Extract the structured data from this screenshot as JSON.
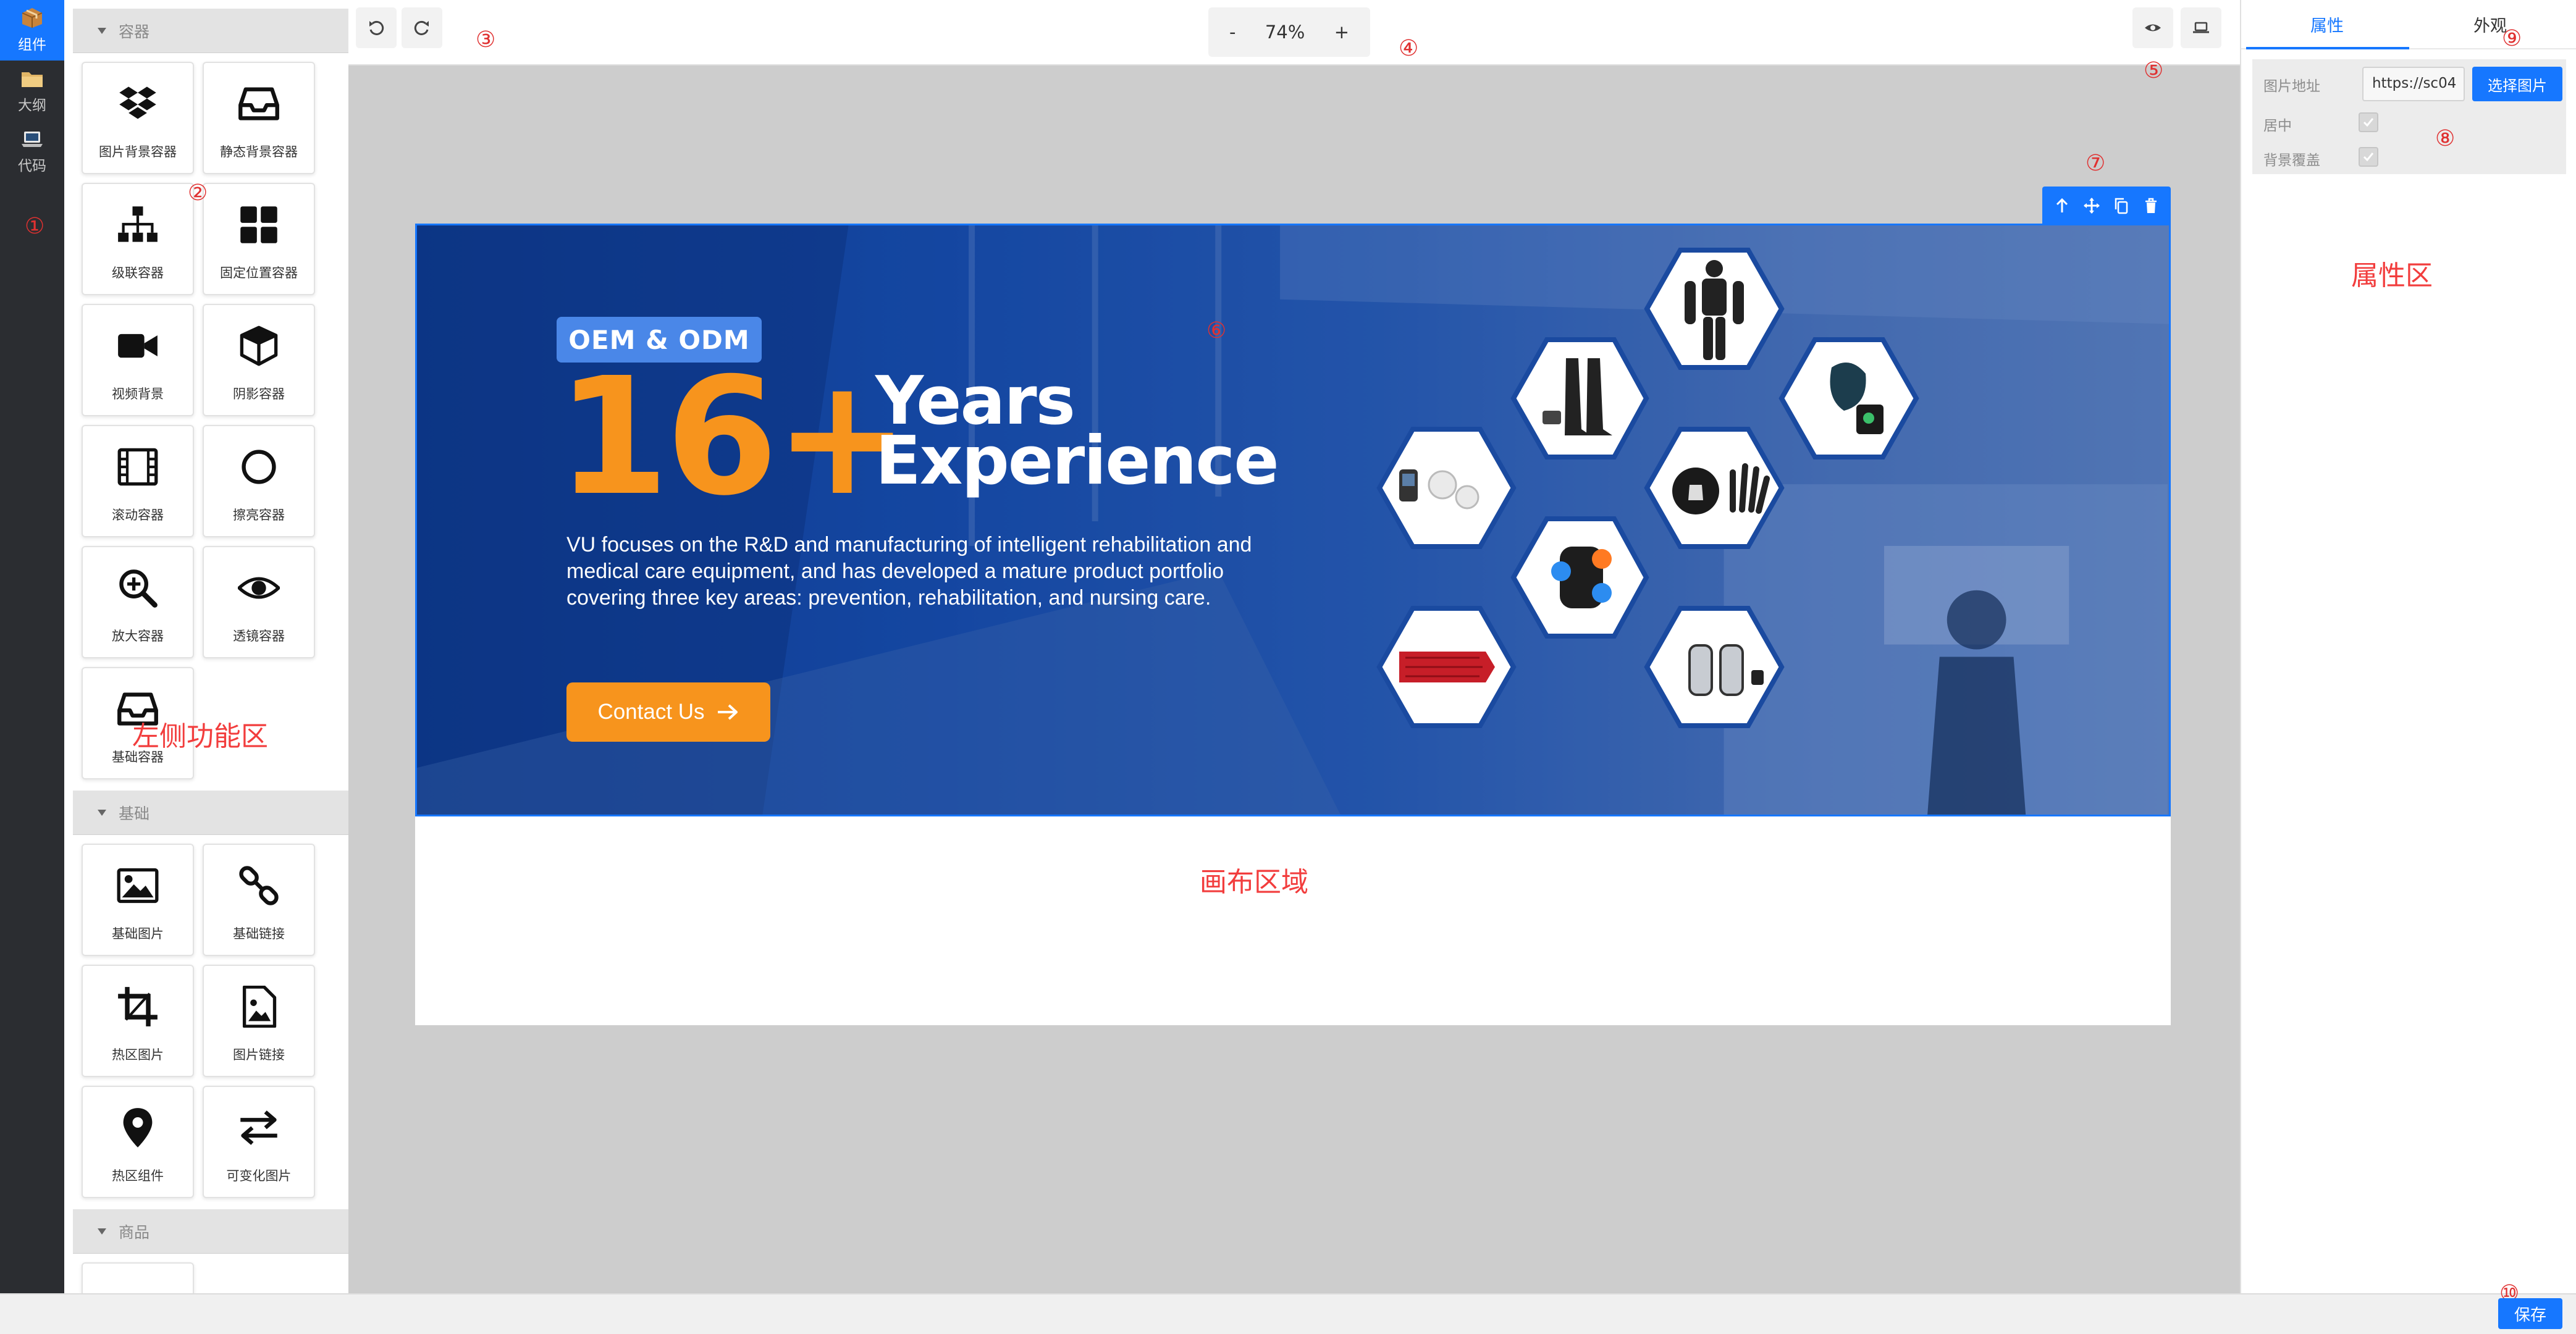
{
  "rail": {
    "items": [
      {
        "label": "组件",
        "icon": "package-icon",
        "active": true
      },
      {
        "label": "大纲",
        "icon": "folder-icon",
        "active": false
      },
      {
        "label": "代码",
        "icon": "laptop-icon",
        "active": false
      }
    ]
  },
  "panel": {
    "region_label": "左侧功能区",
    "groups": [
      {
        "title": "容器",
        "items": [
          {
            "label": "图片背景容器",
            "icon": "dropbox-icon"
          },
          {
            "label": "静态背景容器",
            "icon": "inbox-icon"
          },
          {
            "label": "级联容器",
            "icon": "sitemap-icon"
          },
          {
            "label": "固定位置容器",
            "icon": "grid-icon"
          },
          {
            "label": "视频背景",
            "icon": "video-icon"
          },
          {
            "label": "阴影容器",
            "icon": "cube-icon"
          },
          {
            "label": "滚动容器",
            "icon": "film-icon"
          },
          {
            "label": "擦亮容器",
            "icon": "circle-icon"
          },
          {
            "label": "放大容器",
            "icon": "zoom-in-icon"
          },
          {
            "label": "透镜容器",
            "icon": "eye-icon"
          },
          {
            "label": "基础容器",
            "icon": "inbox-icon"
          }
        ]
      },
      {
        "title": "基础",
        "items": [
          {
            "label": "基础图片",
            "icon": "image-icon"
          },
          {
            "label": "基础链接",
            "icon": "link-icon"
          },
          {
            "label": "热区图片",
            "icon": "crop-icon"
          },
          {
            "label": "图片链接",
            "icon": "image-file-icon"
          },
          {
            "label": "热区组件",
            "icon": "map-pin-icon"
          },
          {
            "label": "可变化图片",
            "icon": "swap-icon"
          }
        ]
      },
      {
        "title": "商品",
        "items": [
          {
            "label": "",
            "icon": "grid-icon"
          }
        ]
      }
    ]
  },
  "toolbar": {
    "zoom_minus": "-",
    "zoom_value": "74%",
    "zoom_plus": "+"
  },
  "markers": {
    "m1": "①",
    "m2": "②",
    "m3": "③",
    "m4": "④",
    "m5": "⑤",
    "m6": "⑥",
    "m7": "⑦",
    "m8": "⑧",
    "m9": "⑨",
    "m10": "⑩"
  },
  "banner": {
    "badge": "OEM & ODM",
    "headline_number": "16+",
    "headline_line1": "Years",
    "headline_line2": "Experience",
    "description": "VU focuses on the R&D and manufacturing of intelligent rehabilitation and medical care equipment, and has developed a mature product portfolio covering three key areas: prevention, rehabilitation, and nursing care.",
    "cta_label": "Contact Us",
    "accent_color": "#f7941d",
    "badge_color": "#4a87e8",
    "background_color": "#1649a6"
  },
  "canvas": {
    "region_label": "画布区域"
  },
  "props": {
    "tab_properties": "属性",
    "tab_appearance": "外观",
    "region_label": "属性区",
    "image_url_label": "图片地址",
    "image_url_value": "https://sc04",
    "choose_image_button": "选择图片",
    "center_label": "居中",
    "center_checked": true,
    "cover_label": "背景覆盖",
    "cover_checked": true
  },
  "footer": {
    "save_label": "保存"
  },
  "colors": {
    "primary": "#1677ff",
    "marker": "#e03131",
    "rail_bg": "#2b2d31"
  }
}
